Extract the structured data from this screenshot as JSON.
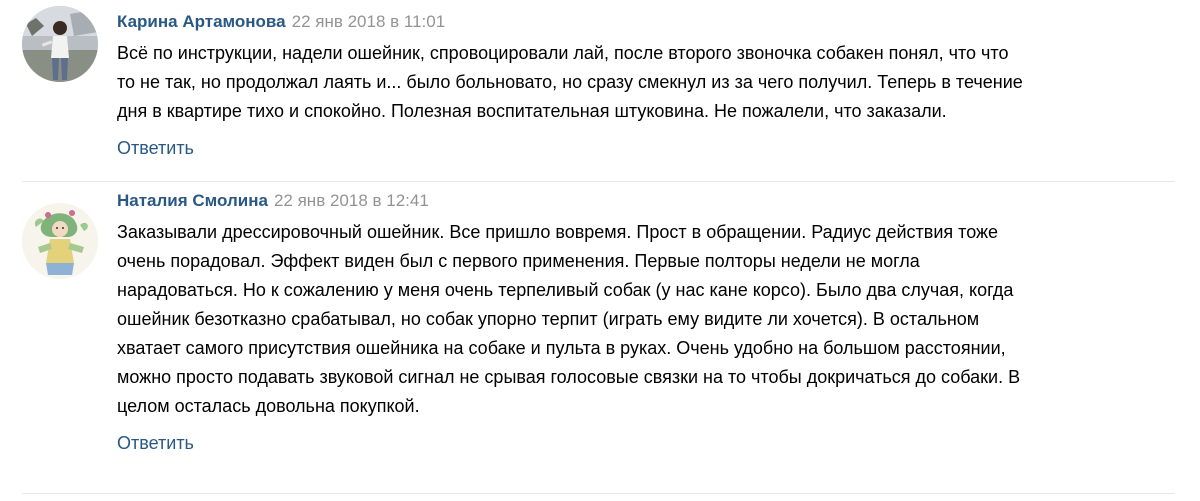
{
  "comments": [
    {
      "author": "Карина Артамонова",
      "date": "22 янв 2018 в 11:01",
      "lines": [
        "Всё по инструкции, надели ошейник, спровоцировали лай, после второго звоночка собакен понял, что что",
        "то не так, но продолжал лаять и... было больновато, но сразу смекнул из за чего получил. Теперь в течение",
        "дня в квартире тихо и спокойно. Полезная воспитательная штуковина. Не пожалели, что заказали."
      ],
      "reply_label": "Ответить",
      "avatar_icon": "user-photo-avatar"
    },
    {
      "author": "Наталия Смолина",
      "date": "22 янв 2018 в 12:41",
      "lines": [
        "Заказывали дрессировочный ошейник. Все пришло вовремя. Прост в обращении. Радиус действия тоже",
        "очень порадовал. Эффект виден был с первого применения. Первые полторы недели не могла",
        "нарадоваться. Но к сожалению у меня очень терпеливый собак (у нас кане корсо). Было два случая, когда",
        "ошейник безотказно срабатывал, но собак упорно терпит (играть ему видите ли хочется). В остальном",
        "хватает самого присутствия ошейника на собаке и пульта в руках. Очень удобно на большом расстоянии,",
        "можно просто подавать звуковой сигнал не срывая голосовые связки на то чтобы докричаться до собаки. В",
        "целом осталась довольна покупкой."
      ],
      "reply_label": "Ответить",
      "avatar_icon": "illustrated-avatar"
    }
  ],
  "colors": {
    "author": "#2a5885",
    "date": "#939393",
    "divider": "#e7e8ec",
    "text": "#000000"
  }
}
